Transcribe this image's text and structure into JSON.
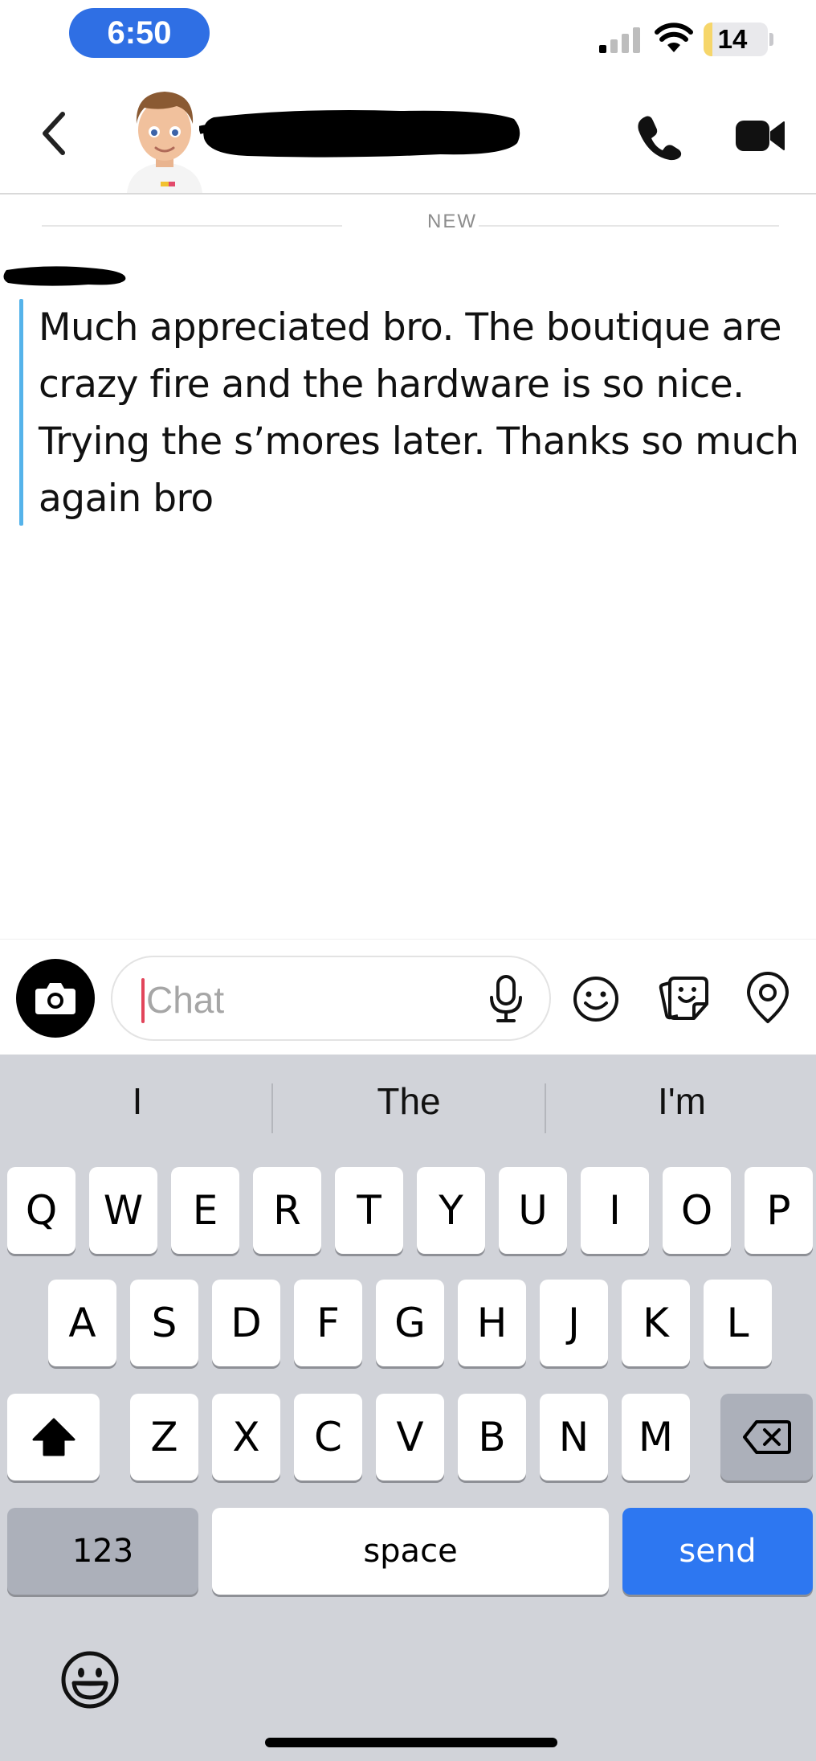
{
  "status_bar": {
    "time": "6:50",
    "battery_percent": 14,
    "battery_label": "14"
  },
  "header": {
    "back_icon": "chevron-left-icon",
    "call_icon": "phone-icon",
    "video_icon": "video-camera-icon"
  },
  "chat": {
    "divider_label": "NEW",
    "message": "Much appreciated bro. The boutique are crazy fire and the hardware is so nice. Trying the s’mores later. Thanks so much again bro"
  },
  "composer": {
    "placeholder": "Chat",
    "icons": [
      "camera-icon",
      "microphone-icon",
      "smiley-icon",
      "sticker-icon",
      "location-pin-icon"
    ]
  },
  "keyboard": {
    "suggestions": [
      "I",
      "The",
      "I'm"
    ],
    "row1": [
      "Q",
      "W",
      "E",
      "R",
      "T",
      "Y",
      "U",
      "I",
      "O",
      "P"
    ],
    "row2": [
      "A",
      "S",
      "D",
      "F",
      "G",
      "H",
      "J",
      "K",
      "L"
    ],
    "row3": [
      "Z",
      "X",
      "C",
      "V",
      "B",
      "N",
      "M"
    ],
    "numbers_label": "123",
    "space_label": "space",
    "send_label": "send"
  },
  "colors": {
    "time_pill": "#2f6fe4",
    "message_bar": "#55b3ea",
    "send_key": "#2d77f1",
    "caret": "#e2455a",
    "keyboard_bg": "#d1d3d9"
  }
}
